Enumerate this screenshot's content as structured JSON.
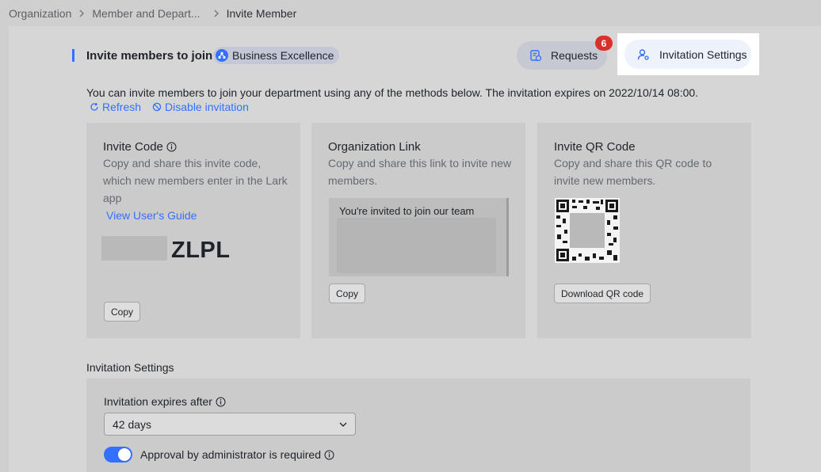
{
  "breadcrumb": {
    "items": [
      "Organization",
      "Member and Depart...",
      "Invite Member"
    ]
  },
  "header": {
    "title": "Invite members to join",
    "department": "Business Excellence",
    "requests_label": "Requests",
    "requests_count": "6",
    "settings_label": "Invitation Settings"
  },
  "intro": {
    "description": "You can invite members to join your department using any of the methods below. The invitation expires on 2022/10/14 08:00.",
    "refresh_label": "Refresh",
    "disable_label": "Disable invitation"
  },
  "invite_code": {
    "title": "Invite Code",
    "description": "Copy and share this invite code, which new members enter in the Lark app",
    "guide_link": "View User's Guide",
    "code_visible": "ZLPL",
    "copy_label": "Copy"
  },
  "org_link": {
    "title": "Organization Link",
    "description": "Copy and share this link to invite new members.",
    "link_text": "You're invited to join our team",
    "copy_label": "Copy"
  },
  "qr_code": {
    "title": "Invite QR Code",
    "description": "Copy and share this QR code to invite new members.",
    "download_label": "Download QR code"
  },
  "settings": {
    "section_title": "Invitation Settings",
    "expires_label": "Invitation expires after",
    "expires_value": "42 days",
    "approval_label": "Approval by administrator is required",
    "approval_enabled": true
  },
  "colors": {
    "accent": "#3370ff",
    "badge": "#d9302c"
  }
}
